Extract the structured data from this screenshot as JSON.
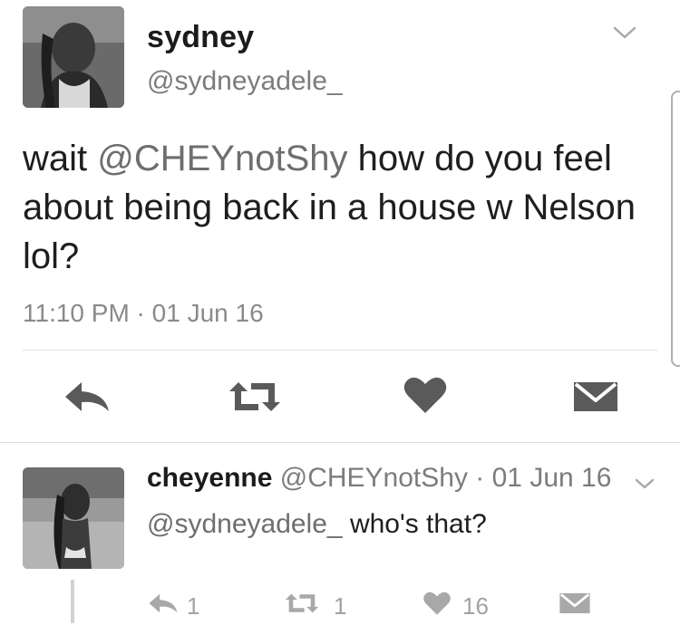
{
  "tweet": {
    "display_name": "sydney",
    "handle": "@sydneyadele_",
    "text_prefix": "wait ",
    "mention": "@CHEYnotShy",
    "text_suffix": " how do you feel about being back in a house w Nelson lol?",
    "timestamp": "11:10 PM · 01 Jun 16",
    "icons": {
      "reply": "reply-icon",
      "retweet": "retweet-icon",
      "like": "heart-icon",
      "dm": "envelope-icon",
      "more": "chevron-down-icon"
    }
  },
  "reply": {
    "display_name": "cheyenne",
    "meta": "@CHEYnotShy · 01 Jun 16",
    "mention": "@sydneyadele_",
    "text": " who's that?",
    "reply_count": "1",
    "retweet_count": "1",
    "like_count": "16"
  },
  "colors": {
    "text": "#1e1e1e",
    "muted": "#7c7c7c",
    "icon": "#5a5a5a",
    "icon_light": "#a8a8a8",
    "divider": "#e2e2e2"
  }
}
